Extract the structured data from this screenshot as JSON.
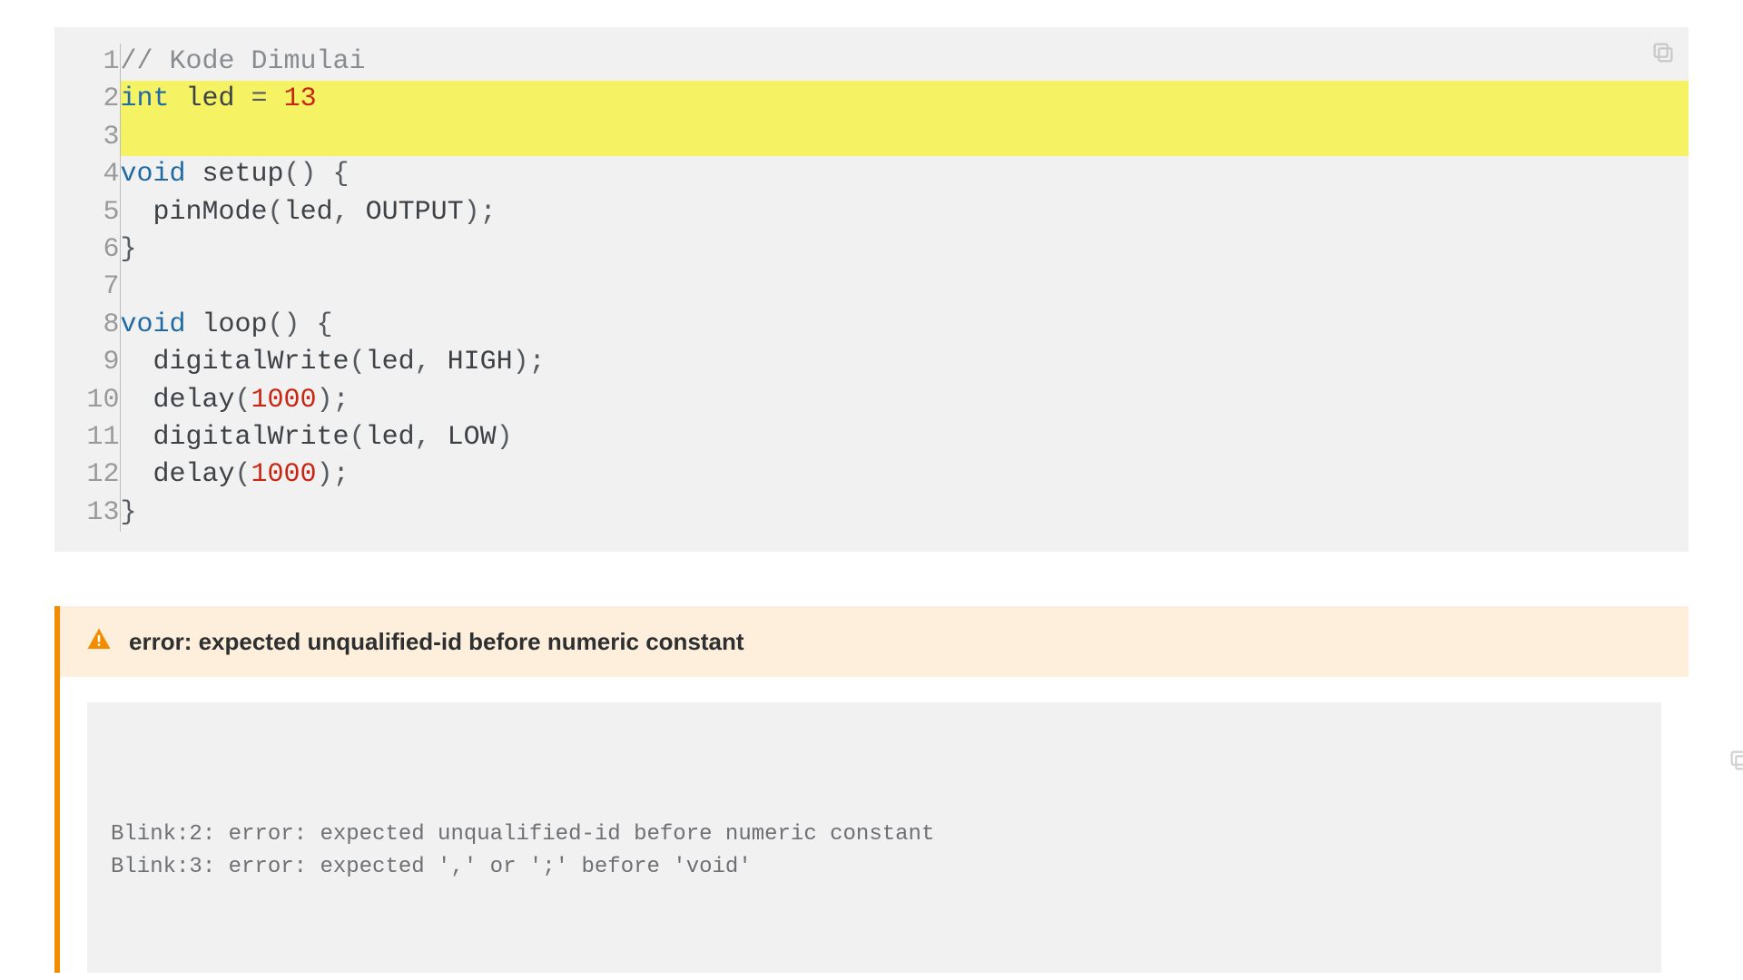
{
  "code": {
    "highlight_from": 2,
    "highlight_to": 3,
    "lines": [
      {
        "n": 1,
        "tokens": [
          {
            "t": "// Kode Dimulai",
            "c": "tok-comment"
          }
        ]
      },
      {
        "n": 2,
        "tokens": [
          {
            "t": "int",
            "c": "tok-type"
          },
          {
            "t": " ",
            "c": "tok-plain"
          },
          {
            "t": "led",
            "c": "tok-ident"
          },
          {
            "t": " = ",
            "c": "tok-punct"
          },
          {
            "t": "13",
            "c": "tok-num"
          }
        ]
      },
      {
        "n": 3,
        "tokens": [
          {
            "t": "",
            "c": "tok-plain"
          }
        ]
      },
      {
        "n": 4,
        "tokens": [
          {
            "t": "void",
            "c": "tok-keyword"
          },
          {
            "t": " ",
            "c": "tok-plain"
          },
          {
            "t": "setup",
            "c": "tok-ident"
          },
          {
            "t": "() {",
            "c": "tok-punct"
          }
        ]
      },
      {
        "n": 5,
        "tokens": [
          {
            "t": "  ",
            "c": "tok-plain"
          },
          {
            "t": "pinMode",
            "c": "tok-ident"
          },
          {
            "t": "(",
            "c": "tok-punct"
          },
          {
            "t": "led",
            "c": "tok-ident"
          },
          {
            "t": ", ",
            "c": "tok-punct"
          },
          {
            "t": "OUTPUT",
            "c": "tok-ident"
          },
          {
            "t": ");",
            "c": "tok-punct"
          }
        ]
      },
      {
        "n": 6,
        "tokens": [
          {
            "t": "}",
            "c": "tok-punct"
          }
        ]
      },
      {
        "n": 7,
        "tokens": [
          {
            "t": "",
            "c": "tok-plain"
          }
        ]
      },
      {
        "n": 8,
        "tokens": [
          {
            "t": "void",
            "c": "tok-keyword"
          },
          {
            "t": " ",
            "c": "tok-plain"
          },
          {
            "t": "loop",
            "c": "tok-ident"
          },
          {
            "t": "() {",
            "c": "tok-punct"
          }
        ]
      },
      {
        "n": 9,
        "tokens": [
          {
            "t": "  ",
            "c": "tok-plain"
          },
          {
            "t": "digitalWrite",
            "c": "tok-ident"
          },
          {
            "t": "(",
            "c": "tok-punct"
          },
          {
            "t": "led",
            "c": "tok-ident"
          },
          {
            "t": ", ",
            "c": "tok-punct"
          },
          {
            "t": "HIGH",
            "c": "tok-ident"
          },
          {
            "t": ");",
            "c": "tok-punct"
          }
        ]
      },
      {
        "n": 10,
        "tokens": [
          {
            "t": "  ",
            "c": "tok-plain"
          },
          {
            "t": "delay",
            "c": "tok-ident"
          },
          {
            "t": "(",
            "c": "tok-punct"
          },
          {
            "t": "1000",
            "c": "tok-num"
          },
          {
            "t": ");",
            "c": "tok-punct"
          }
        ]
      },
      {
        "n": 11,
        "tokens": [
          {
            "t": "  ",
            "c": "tok-plain"
          },
          {
            "t": "digitalWrite",
            "c": "tok-ident"
          },
          {
            "t": "(",
            "c": "tok-punct"
          },
          {
            "t": "led",
            "c": "tok-ident"
          },
          {
            "t": ", ",
            "c": "tok-punct"
          },
          {
            "t": "LOW",
            "c": "tok-ident"
          },
          {
            "t": ")",
            "c": "tok-punct"
          }
        ]
      },
      {
        "n": 12,
        "tokens": [
          {
            "t": "  ",
            "c": "tok-plain"
          },
          {
            "t": "delay",
            "c": "tok-ident"
          },
          {
            "t": "(",
            "c": "tok-punct"
          },
          {
            "t": "1000",
            "c": "tok-num"
          },
          {
            "t": ");",
            "c": "tok-punct"
          }
        ]
      },
      {
        "n": 13,
        "tokens": [
          {
            "t": "}",
            "c": "tok-punct"
          }
        ]
      }
    ]
  },
  "error": {
    "title": "error: expected unqualified-id before numeric constant",
    "lines": [
      "Blink:2: error: expected unqualified-id before numeric constant",
      "Blink:3: error: expected ',' or ';' before 'void'"
    ]
  }
}
